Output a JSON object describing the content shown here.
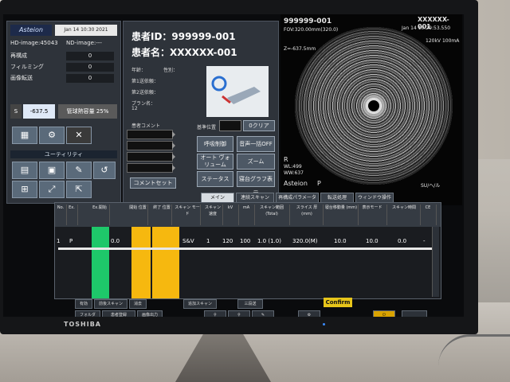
{
  "brand": "TOSHIBA",
  "left_panel": {
    "logo": "Asteion",
    "datetime": "Jan 14 10:30 2021",
    "hd_image": "HD-image:45043",
    "nd_image": "ND-image:---",
    "rows": [
      {
        "label": "再構成",
        "value": "0"
      },
      {
        "label": "フィルミング",
        "value": "0"
      },
      {
        "label": "画像転送",
        "value": "0"
      }
    ],
    "indicator": {
      "left": "S",
      "middle": "-637.5",
      "right": "管球熱容量 25%"
    },
    "utility": "ユーティリティ",
    "icons": [
      "Filming",
      "Ganatee",
      "Windows",
      "Extended Mode",
      "Reset"
    ]
  },
  "center_panel": {
    "patient_id": "患者ID：999999-001",
    "patient_name": "患者名：XXXXXX-001",
    "age": "年齢：",
    "sex": "性別：",
    "dept1": "第1送依頼：",
    "dept2": "第2送依頼：",
    "plan": "プラン名：",
    "plan_no": "12",
    "comment": "患者コメント",
    "buttons": [
      "呼吸制御",
      "音声一括OFF",
      "オート ヴォリューム",
      "ズーム",
      "ステータス",
      "寝台グラフ表示"
    ],
    "locate": "基準位置",
    "zero_clear": "0クリア",
    "comment_set": "コメントセット"
  },
  "viewer": {
    "id": "999999-001",
    "name": "XXXXXX-001",
    "date": "Jan 14 10:29:53.550",
    "fov": "FOV:320.00mm(320.0)",
    "z": "Z=-637.5mm",
    "r": "R",
    "wl": "WL:499",
    "ww": "WW:637",
    "footer_left": "Asteion",
    "footer_p": "P",
    "footer_right": "SU/ヘ/ル",
    "kv": "120kV 100mA"
  },
  "tabs": [
    "メイン",
    "連続スキャン",
    "再構成パラメータ",
    "転送処理",
    "ウィンドウ操作"
  ],
  "table": {
    "headers": [
      "No.",
      "Ex.",
      "Ex.開始",
      "開始 位置",
      "終了 位置",
      "スキャン モード",
      "スキャン速度",
      "kV",
      "mA",
      "スキャン範囲 (Total)",
      "スライス 厚(mm)",
      "寝台移動量 (mm)",
      "表示モード",
      "スキャン時間",
      "CE"
    ],
    "row": {
      "no": "1",
      "ex": "P",
      "start": "0.0",
      "mode": "S&V",
      "n": "1",
      "kv": "120",
      "ma": "100",
      "range": "1.0 (1.0)",
      "fov": "320.0(M)",
      "thick": "10.0",
      "move": "10.0",
      "time": "0.0",
      "ce": "-"
    }
  },
  "bottom": {
    "b1": "有効",
    "b2": "前後スキャン",
    "b3": "消去",
    "b4": "追加スキャン",
    "b5": "三段送",
    "confirm": "Confirm",
    "b6": "フォルダ",
    "b7": "患者登録",
    "b8": "画像出力"
  }
}
